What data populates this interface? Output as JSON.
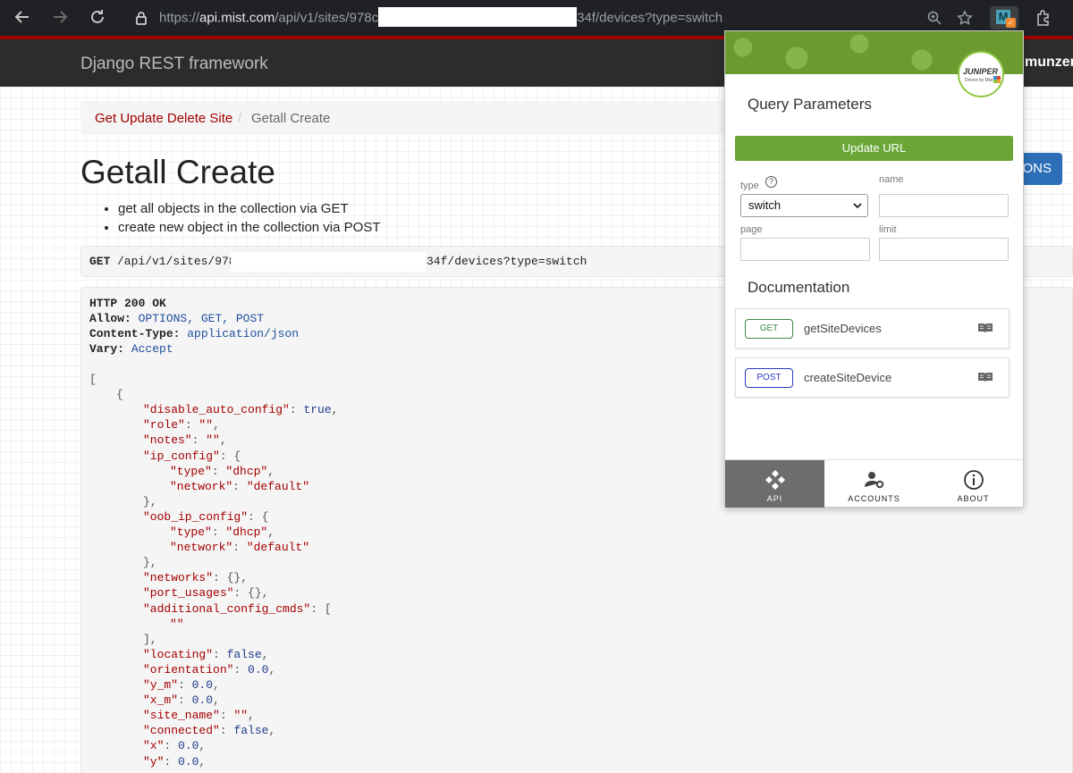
{
  "browser": {
    "url_scheme": "https://",
    "url_host": "api.mist.com",
    "url_path_before": "/api/v1/sites/978c",
    "url_path_after": "34f/devices?type=switch"
  },
  "drf": {
    "brand": "Django REST framework",
    "user": "munzer@"
  },
  "breadcrumb": {
    "parent": "Get Update Delete Site",
    "separator": "/",
    "current": "Getall Create"
  },
  "options_label": "ONS",
  "page_title": "Getall Create",
  "description": [
    "get all objects in the collection via GET",
    "create new object in the collection via POST"
  ],
  "request": {
    "method": "GET",
    "path_before": "/api/v1/sites/978c",
    "path_after": "34f/devices?type=switch"
  },
  "response": {
    "status": "HTTP 200 OK",
    "headers": [
      {
        "name": "Allow:",
        "value": "OPTIONS, GET, POST"
      },
      {
        "name": "Content-Type:",
        "value": "application/json"
      },
      {
        "name": "Vary:",
        "value": "Accept"
      }
    ]
  },
  "popup": {
    "logo_text": "JUNIPER",
    "logo_sub": "Driven by Mist AI",
    "query_heading": "Query Parameters",
    "update_button": "Update URL",
    "type_label": "type",
    "type_value": "switch",
    "name_label": "name",
    "page_label": "page",
    "limit_label": "limit",
    "doc_heading": "Documentation",
    "docs": [
      {
        "method": "GET",
        "name": "getSiteDevices"
      },
      {
        "method": "POST",
        "name": "createSiteDevice"
      }
    ],
    "tabs": [
      "API",
      "ACCOUNTS",
      "ABOUT"
    ]
  },
  "colors": {
    "drf_red": "#a30000",
    "update_green": "#6aa736",
    "options_blue": "#2c6fb7"
  }
}
